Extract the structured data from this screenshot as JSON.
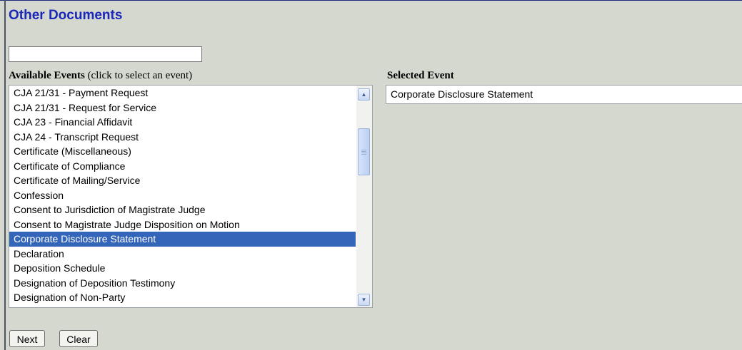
{
  "page": {
    "title": "Other Documents"
  },
  "search": {
    "value": ""
  },
  "available": {
    "label_bold": "Available Events",
    "label_hint": " (click to select an event)",
    "items": [
      "CJA 21/31 - Payment Request",
      "CJA 21/31 - Request for Service",
      "CJA 23 - Financial Affidavit",
      "CJA 24 - Transcript Request",
      "Certificate (Miscellaneous)",
      "Certificate of Compliance",
      "Certificate of Mailing/Service",
      "Confession",
      "Consent to Jurisdiction of Magistrate Judge",
      "Consent to Magistrate Judge Disposition on Motion",
      "Corporate Disclosure Statement",
      "Declaration",
      "Deposition Schedule",
      "Designation of Deposition Testimony",
      "Designation of Non-Party"
    ],
    "selected_index": 10
  },
  "selected": {
    "label": "Selected Event",
    "value": "Corporate Disclosure Statement"
  },
  "buttons": {
    "next": "Next",
    "clear": "Clear"
  },
  "colors": {
    "page_bg": "#d4d8cf",
    "title": "#1a27b8",
    "selection": "#3366b8"
  }
}
